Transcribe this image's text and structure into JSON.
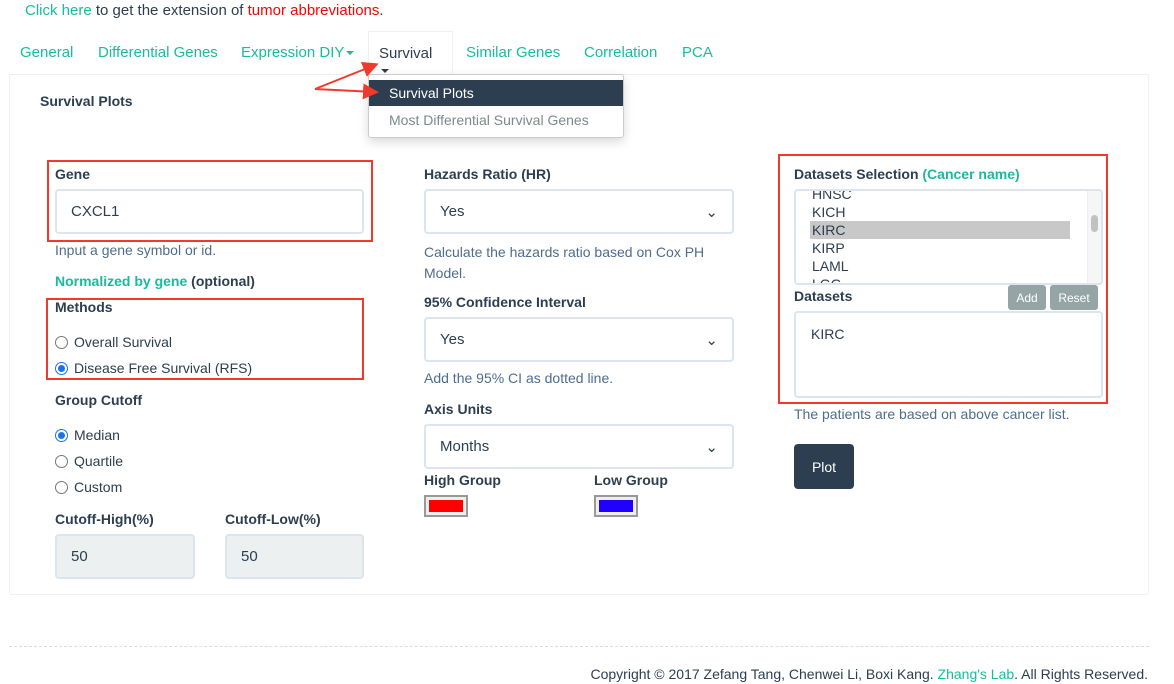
{
  "notice": {
    "link": "Click here",
    "middle": " to get the extension of ",
    "red": "tumor abbreviations",
    "end": "."
  },
  "tabs": [
    {
      "label": "General"
    },
    {
      "label": "Differential Genes"
    },
    {
      "label": "Expression DIY"
    },
    {
      "label": "Survival"
    },
    {
      "label": "Similar Genes"
    },
    {
      "label": "Correlation"
    },
    {
      "label": "PCA"
    }
  ],
  "dropdown": {
    "items": [
      {
        "label": "Survival Plots",
        "active": true
      },
      {
        "label": "Most Differential Survival Genes"
      }
    ]
  },
  "panel": {
    "title": "Survival Plots"
  },
  "gene": {
    "label": "Gene",
    "value": "CXCL1",
    "help": "Input a gene symbol or id."
  },
  "normalized": {
    "link": "Normalized by gene",
    "suffix": " (optional)"
  },
  "methods": {
    "label": "Methods",
    "options": [
      {
        "label": "Overall Survival",
        "checked": false
      },
      {
        "label": "Disease Free Survival (RFS)",
        "checked": true
      }
    ]
  },
  "cutoff": {
    "label": "Group Cutoff",
    "options": [
      {
        "label": "Median",
        "checked": true
      },
      {
        "label": "Quartile",
        "checked": false
      },
      {
        "label": "Custom",
        "checked": false
      }
    ],
    "high_label": "Cutoff-High(%)",
    "high_value": "50",
    "low_label": "Cutoff-Low(%)",
    "low_value": "50"
  },
  "hr": {
    "label": "Hazards Ratio (HR)",
    "value": "Yes",
    "help": "Calculate the hazards ratio based on Cox PH Model."
  },
  "ci": {
    "label": "95% Confidence Interval",
    "value": "Yes",
    "help": "Add the 95% CI as dotted line."
  },
  "axis": {
    "label": "Axis Units",
    "value": "Months"
  },
  "groups": {
    "high_label": "High Group",
    "high_color": "#ff0000",
    "low_label": "Low Group",
    "low_color": "#2200ff"
  },
  "datasets": {
    "label": "Datasets Selection",
    "label_green": "(Cancer name)",
    "list": [
      "HNSC",
      "KICH",
      "KIRC",
      "KIRP",
      "LAML",
      "LGG"
    ],
    "selected": "KIRC",
    "box_label": "Datasets",
    "add": "Add",
    "reset": "Reset",
    "value": "KIRC",
    "help": "The patients are based on above cancer list."
  },
  "plot_button": "Plot",
  "footer": {
    "text": "Copyright © 2017 Zefang Tang, Chenwei Li, Boxi Kang. ",
    "lab": "Zhang's Lab",
    "end": ". All Rights Reserved."
  }
}
